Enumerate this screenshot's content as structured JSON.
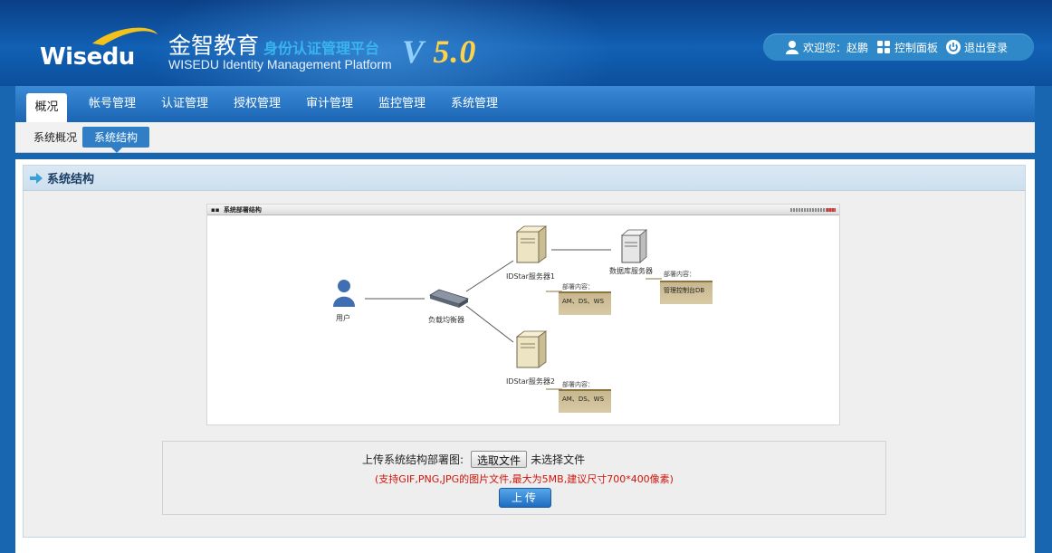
{
  "header": {
    "logo_text": "Wisedu",
    "brand_cn": "金智教育",
    "brand_sub": "身份认证管理平台",
    "brand_en": "WISEDU Identity Management Platform",
    "version_v": "V",
    "version_num": "5.0",
    "welcome_label": "欢迎您：赵鹏",
    "control_panel_label": "控制面板",
    "logout_label": "退出登录"
  },
  "nav": {
    "tabs": [
      {
        "label": "概况",
        "active": true
      },
      {
        "label": "帐号管理"
      },
      {
        "label": "认证管理"
      },
      {
        "label": "授权管理"
      },
      {
        "label": "审计管理"
      },
      {
        "label": "监控管理"
      },
      {
        "label": "系统管理"
      }
    ]
  },
  "subnav": {
    "items": [
      {
        "label": "系统概况"
      },
      {
        "label": "系统结构",
        "active": true
      }
    ]
  },
  "panel": {
    "title": "系统结构"
  },
  "diagram": {
    "title": "系统部署结构",
    "nodes": {
      "user": "用户",
      "load_balancer": "负载均衡器",
      "server1": "IDStar服务器1",
      "server2": "IDStar服务器2",
      "db_server": "数据库服务器"
    },
    "notes": {
      "title": "部署内容：",
      "server1": "AM、DS、WS",
      "server2": "AM、DS、WS",
      "db": "管理控制台DB"
    }
  },
  "upload": {
    "label": "上传系统结构部署图:",
    "file_button": "选取文件",
    "file_status": "未选择文件",
    "hint": "(支持GIF,PNG,JPG的图片文件,最大为5MB,建议尺寸700*400像素)",
    "submit_label": "上传"
  },
  "colors": {
    "header_bg": "#1160b4",
    "nav_bg": "#1a65b4",
    "accent": "#2f7ec6",
    "hint_red": "#d0140a",
    "version_gold": "#ffd24a"
  }
}
